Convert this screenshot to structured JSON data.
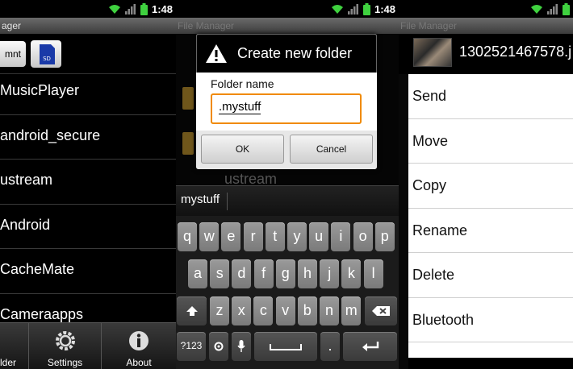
{
  "status": {
    "time": "1:48"
  },
  "panel1": {
    "title": "ager",
    "mnt_label": "mnt",
    "sd_label": "SD",
    "items": [
      "MusicPlayer",
      "android_secure",
      "ustream",
      "Android",
      "CacheMate",
      "Cameraapps"
    ],
    "tabs": [
      {
        "label": "lder"
      },
      {
        "label": "Settings"
      },
      {
        "label": "About"
      }
    ]
  },
  "panel2": {
    "title": "File Manager",
    "background_item": "ustream",
    "dialog": {
      "title": "Create new folder",
      "field_label": "Folder name",
      "field_value": ".mystuff",
      "ok_label": "OK",
      "cancel_label": "Cancel"
    },
    "suggestion": "mystuff",
    "keyboard": {
      "row1": [
        "q",
        "w",
        "e",
        "r",
        "t",
        "y",
        "u",
        "i",
        "o",
        "p"
      ],
      "row2": [
        "a",
        "s",
        "d",
        "f",
        "g",
        "h",
        "j",
        "k",
        "l"
      ],
      "row3": [
        "z",
        "x",
        "c",
        "v",
        "b",
        "n",
        "m"
      ],
      "sym_label": "?123",
      "period_label": "."
    }
  },
  "panel3": {
    "title": "File Manager",
    "file_name": "1302521467578.j",
    "menu": [
      "Send",
      "Move",
      "Copy",
      "Rename",
      "Delete",
      "Bluetooth"
    ]
  },
  "colors": {
    "accent": "#f08a00",
    "menu_bg": "#ffffff",
    "key": "#8a8a8a"
  }
}
